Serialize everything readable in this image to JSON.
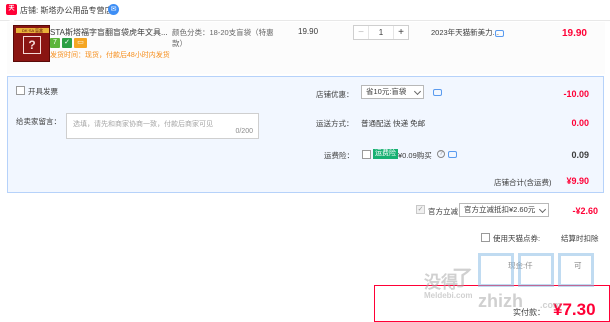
{
  "shop": {
    "logo_text": "天猫",
    "name": "店铺: 斯塔办公用品专营店"
  },
  "item": {
    "thumb_tag": "DK·SA 盲盒",
    "thumb_glyph": "?",
    "title": "STA斯塔福字盲翻盲袋虎年文具...",
    "badges": [
      "7",
      "",
      ""
    ],
    "ship_time": "发货时间：现货，付款后48小时内发货",
    "sku": "颜色分类：18-20支盲袋（特惠款）",
    "unit_price": "19.90",
    "quantity": "1",
    "qty_minus": "−",
    "qty_plus": "+",
    "promo": "2023年天猫新美力...",
    "line_total": "19.90"
  },
  "options": {
    "invoice_label": "开具发票",
    "shop_discount_label": "店铺优惠：",
    "shop_discount_value": "省10元:盲袋",
    "shop_discount_amount": "-10.00",
    "message_label": "给卖家留言：",
    "message_placeholder": "选填，请先和商家协商一致，付款后商家可见",
    "message_counter": "0/200",
    "shipping_label": "运送方式：",
    "shipping_value": "普通配送 快递 免邮",
    "shipping_amount": "0.00",
    "insurance_label": "运费险：",
    "insurance_tag": "运费险",
    "insurance_value": "¥0.09购买",
    "insurance_amount": "0.09"
  },
  "totals": {
    "shop_total_label": "店铺合计(含运费)",
    "shop_total_value": "¥9.90",
    "official_label": "官方立减",
    "official_select": "官方立减抵扣¥2.60元",
    "official_amount": "-¥2.60",
    "points_label": "使用天猫点券:",
    "points_note": "结算时扣除",
    "row3_label": "现金:仟",
    "row3_value": "可",
    "pay_label": "实付款：",
    "pay_value": "¥7.30"
  },
  "watermark": {
    "text_cn": "没得",
    "text_cn2": "了",
    "text_en": "Meldebi.com",
    "text_zhi": "zhizh",
    "text_com": ".com"
  },
  "colors": {
    "accent_red": "#ff0036",
    "panel_bg": "#f2f7ff",
    "panel_border": "#b6d2fa",
    "link_blue": "#3d8ef5",
    "orange": "#f68d1a",
    "green": "#17b072"
  },
  "icons": [
    "tmall-logo-icon",
    "wangwang-icon",
    "chat-icon",
    "question-icon",
    "chevron-down-icon",
    "checkbox-icon"
  ]
}
